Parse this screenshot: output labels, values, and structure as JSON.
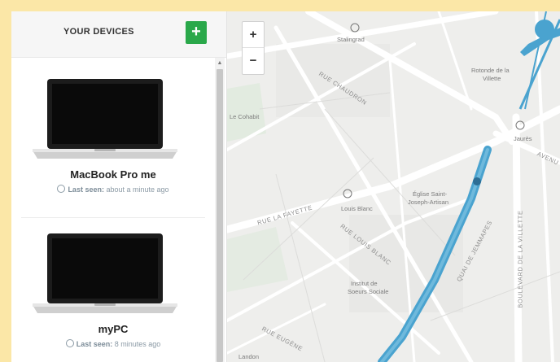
{
  "sidebar": {
    "title": "YOUR DEVICES",
    "add_label": "+"
  },
  "devices": [
    {
      "name": "MacBook Pro me",
      "last_seen_label": "Last seen:",
      "last_seen_value": "about a minute ago"
    },
    {
      "name": "myPC",
      "last_seen_label": "Last seen:",
      "last_seen_value": "8 minutes ago"
    }
  ],
  "map": {
    "zoom_in_label": "+",
    "zoom_out_label": "−",
    "labels": {
      "stalingrad": "Stalingrad",
      "rue_chaudron": "RUE CHAUDRON",
      "rotonde": "Rotonde de la",
      "rotonde2": "Villette",
      "jaures": "Jaurès",
      "avenue": "AVENU",
      "le_cohabit": "Le Cohabit",
      "rue_la_fayette": "RUE LA FAYETTE",
      "louis_blanc": "Louis Blanc",
      "rue_louis_blanc": "RUE LOUIS BLANC",
      "eglise1": "Église Saint-",
      "eglise2": "Joseph-Artisan",
      "quai": "QUAI DE JEMMAPES",
      "institut1": "Institut de",
      "institut2": "Soeurs Sociale",
      "boulevard": "BOULEVARD DE LA VILLETTE",
      "rue_eugene": "RUE EUGÈNE",
      "landon": "Landon"
    }
  },
  "colors": {
    "accent_green": "#2aa84a",
    "canal_blue": "#4aa3cf"
  }
}
